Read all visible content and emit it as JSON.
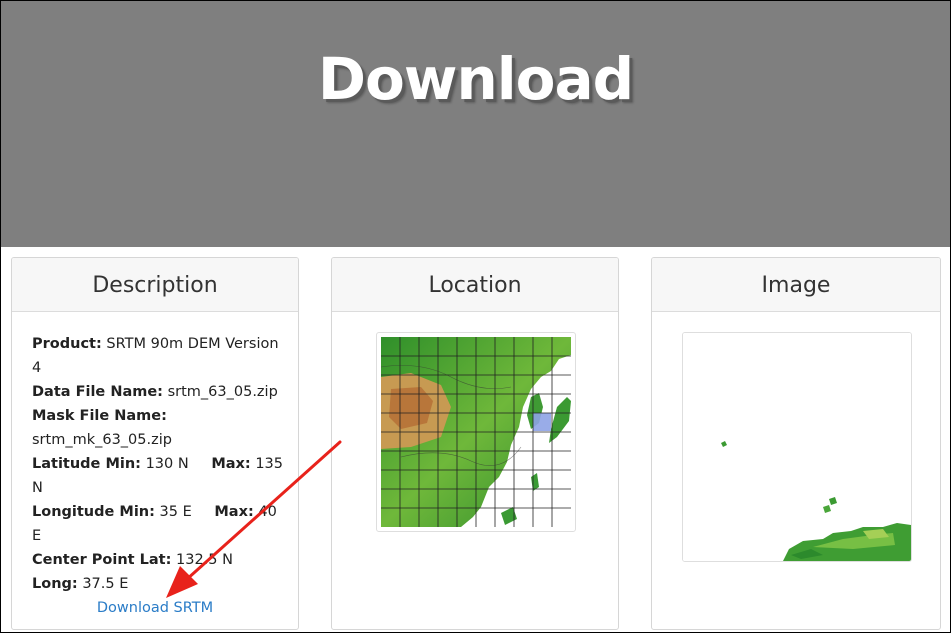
{
  "header": {
    "title": "Download"
  },
  "description": {
    "heading": "Description",
    "product_label": "Product:",
    "product_value": "SRTM 90m DEM Version 4",
    "data_file_label": "Data File Name:",
    "data_file_value": "srtm_63_05.zip",
    "mask_file_label": "Mask File Name:",
    "mask_file_value": "srtm_mk_63_05.zip",
    "lat_min_label": "Latitude Min:",
    "lat_min_value": "130 N",
    "lat_max_label": "Max:",
    "lat_max_value": "135 N",
    "lon_min_label": "Longitude Min:",
    "lon_min_value": "35 E",
    "lon_max_label": "Max:",
    "lon_max_value": "40 E",
    "center_lat_label": "Center Point Lat:",
    "center_lat_value": "132.5 N",
    "center_long_label": "Long:",
    "center_long_value": "37.5 E",
    "download_link": "Download SRTM"
  },
  "location": {
    "heading": "Location"
  },
  "image": {
    "heading": "Image"
  },
  "colors": {
    "hero_bg": "#7f7f7f",
    "link": "#2a7cc7",
    "arrow": "#e8221b",
    "highlight_tile": "#8ea3e6"
  }
}
